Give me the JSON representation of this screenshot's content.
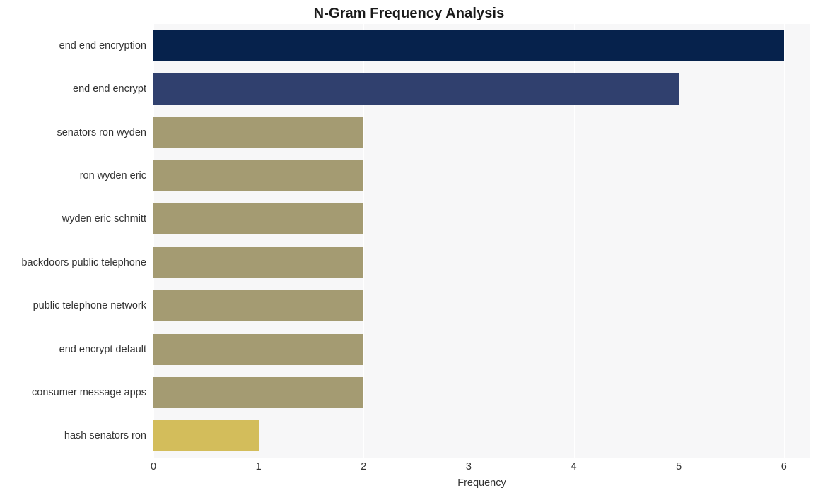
{
  "chart_data": {
    "type": "bar",
    "orientation": "horizontal",
    "title": "N-Gram Frequency Analysis",
    "xlabel": "Frequency",
    "ylabel": "",
    "xlim": [
      0,
      6.25
    ],
    "xticks": [
      "0",
      "1",
      "2",
      "3",
      "4",
      "5",
      "6"
    ],
    "xtick_values": [
      0,
      1,
      2,
      3,
      4,
      5,
      6
    ],
    "grid": "vertical-white",
    "legend": "none",
    "categories": [
      "end end encryption",
      "end end encrypt",
      "senators ron wyden",
      "ron wyden eric",
      "wyden eric schmitt",
      "backdoors public telephone",
      "public telephone network",
      "end encrypt default",
      "consumer message apps",
      "hash senators ron"
    ],
    "values": [
      6,
      5,
      2,
      2,
      2,
      2,
      2,
      2,
      2,
      1
    ],
    "bar_colors": [
      "#06224c",
      "#30406e",
      "#a49b72",
      "#a49b72",
      "#a49b72",
      "#a49b72",
      "#a49b72",
      "#a49b72",
      "#a49b72",
      "#d3bd5b"
    ],
    "plot_background": "#f7f7f8",
    "figure_background": "#ffffff",
    "text_color": "#333333",
    "title_color": "#1a1a1a"
  }
}
